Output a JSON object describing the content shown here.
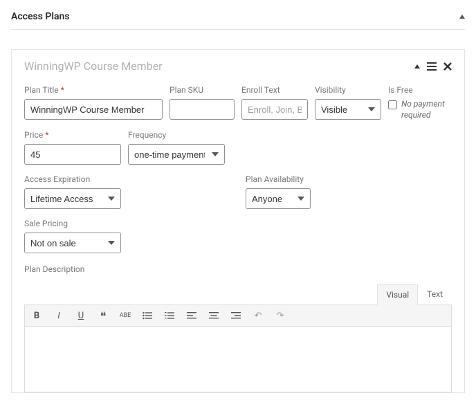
{
  "panel": {
    "title": "Access Plans"
  },
  "card": {
    "title": "WinningWP Course Member"
  },
  "fields": {
    "plan_title": {
      "label": "Plan Title",
      "value": "WinningWP Course Member"
    },
    "plan_sku": {
      "label": "Plan SKU",
      "value": ""
    },
    "enroll_text": {
      "label": "Enroll Text",
      "placeholder": "Enroll, Join, Buy…",
      "value": ""
    },
    "visibility": {
      "label": "Visibility",
      "value": "Visible"
    },
    "is_free": {
      "label": "Is Free",
      "note": "No payment required",
      "checked": false
    },
    "price": {
      "label": "Price",
      "value": "45"
    },
    "frequency": {
      "label": "Frequency",
      "value": "one-time payment"
    },
    "access_expiration": {
      "label": "Access Expiration",
      "value": "Lifetime Access"
    },
    "plan_availability": {
      "label": "Plan Availability",
      "value": "Anyone"
    },
    "sale_pricing": {
      "label": "Sale Pricing",
      "value": "Not on sale"
    },
    "plan_description": {
      "label": "Plan Description"
    }
  },
  "editor": {
    "tabs": {
      "visual": "Visual",
      "text": "Text"
    }
  }
}
